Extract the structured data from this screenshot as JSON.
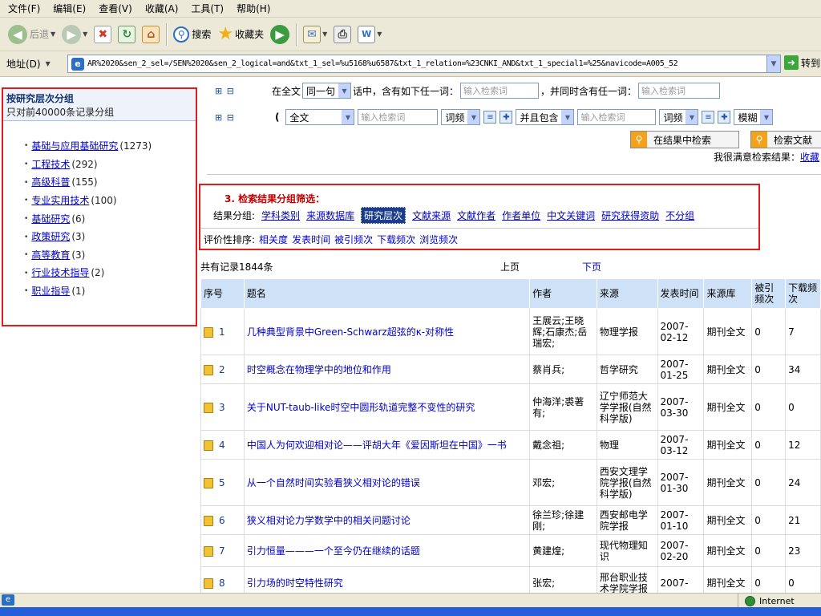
{
  "menu": [
    "文件(F)",
    "编辑(E)",
    "查看(V)",
    "收藏(A)",
    "工具(T)",
    "帮助(H)"
  ],
  "toolbar": {
    "back": "后退",
    "search": "搜索",
    "favorites": "收藏夹"
  },
  "address": {
    "label": "地址(D)",
    "url": "AR%2020&sen_2_sel=/SEN%2020&sen_2_logical=and&txt_1_sel=%u5168%u6587&txt_1_relation=%23CNKI_AND&txt_1_special1=%25&navicode=A005_52",
    "go": "转到"
  },
  "left_panel": {
    "title": "按研究层次分组",
    "subtitle": "只对前40000条记录分组",
    "items": [
      {
        "label": "基础与应用基础研究",
        "count": "(1273)"
      },
      {
        "label": "工程技术",
        "count": "(292)"
      },
      {
        "label": "高级科普",
        "count": "(155)"
      },
      {
        "label": "专业实用技术",
        "count": "(100)"
      },
      {
        "label": "基础研究",
        "count": "(6)"
      },
      {
        "label": "政策研究",
        "count": "(3)"
      },
      {
        "label": "高等教育",
        "count": "(3)"
      },
      {
        "label": "行业技术指导",
        "count": "(2)"
      },
      {
        "label": "职业指导",
        "count": "(1)"
      }
    ]
  },
  "search": {
    "row1": {
      "pre": "在全文",
      "scope": "同一句",
      "mid": "话中，含有如下任一词：",
      "placeholder1": "输入检索词",
      "mid2": "，并同时含有任一词：",
      "placeholder2": "输入检索词"
    },
    "row2": {
      "paren": "(",
      "field": "全文",
      "placeholder1": "输入检索词",
      "freq1": "词频",
      "logic": "并且包含",
      "placeholder2": "输入检索词",
      "freq2": "词频",
      "match": "模糊"
    },
    "btn_in_results": "在结果中检索",
    "btn_search": "检索文献",
    "satisfied_pre": "我很满意检索结果：",
    "satisfied_link": "收藏"
  },
  "grouping": {
    "title": "3. 检索结果分组筛选：",
    "label": "结果分组:",
    "options": [
      "学科类别",
      "来源数据库",
      "研究层次",
      "文献来源",
      "文献作者",
      "作者单位",
      "中文关键词",
      "研究获得资助",
      "不分组"
    ],
    "active": "研究层次",
    "rank_label": "评价性排序:",
    "rank_options": [
      "相关度",
      "发表时间",
      "被引频次",
      "下载频次",
      "浏览频次"
    ]
  },
  "records": {
    "total": "共有记录1844条",
    "prev": "上页",
    "next": "下页"
  },
  "table": {
    "headers": [
      "序号",
      "题名",
      "作者",
      "来源",
      "发表时间",
      "来源库",
      "被引频次",
      "下载频次"
    ],
    "rows": [
      {
        "no": "1",
        "title": "几种典型背景中Green-Schwarz超弦的κ-对称性",
        "author": "王展云;王晓辉;石康杰;岳瑞宏;",
        "source": "物理学报",
        "date": "2007-02-12",
        "db": "期刊全文",
        "cited": "0",
        "downloads": "7"
      },
      {
        "no": "2",
        "title": "时空概念在物理学中的地位和作用",
        "author": "蔡肖兵;",
        "source": "哲学研究",
        "date": "2007-01-25",
        "db": "期刊全文",
        "cited": "0",
        "downloads": "34"
      },
      {
        "no": "3",
        "title": "关于NUT-taub-like时空中圆形轨道完整不变性的研究",
        "author": "仲海洋;裘著有;",
        "source": "辽宁师范大学学报(自然科学版)",
        "date": "2007-03-30",
        "db": "期刊全文",
        "cited": "0",
        "downloads": "0"
      },
      {
        "no": "4",
        "title": "中国人为何欢迎相对论——评胡大年《爱因斯坦在中国》一书",
        "author": "戴念祖;",
        "source": "物理",
        "date": "2007-03-12",
        "db": "期刊全文",
        "cited": "0",
        "downloads": "12"
      },
      {
        "no": "5",
        "title": "从一个自然时间实验看狭义相对论的错误",
        "author": "邓宏;",
        "source": "西安文理学院学报(自然科学版)",
        "date": "2007-01-30",
        "db": "期刊全文",
        "cited": "0",
        "downloads": "24"
      },
      {
        "no": "6",
        "title": "狭义相对论力学数学中的相关问题讨论",
        "author": "徐兰珍;徐建刚;",
        "source": "西安邮电学院学报",
        "date": "2007-01-10",
        "db": "期刊全文",
        "cited": "0",
        "downloads": "21"
      },
      {
        "no": "7",
        "title": "引力恒量———一个至今仍在继续的话题",
        "author": "黄建煌;",
        "source": "现代物理知识",
        "date": "2007-02-20",
        "db": "期刊全文",
        "cited": "0",
        "downloads": "23"
      },
      {
        "no": "8",
        "title": "引力场的时空特性研究",
        "author": "张宏;",
        "source": "邢台职业技术学院学报",
        "date": "2007-",
        "db": "期刊全文",
        "cited": "0",
        "downloads": "0"
      }
    ]
  },
  "status": {
    "zone": "Internet"
  },
  "colors": {
    "highlight_border": "#e31b1b",
    "link": "#0000cc",
    "table_header": "#cfe1f7",
    "active_group": "#1a3c8c"
  }
}
